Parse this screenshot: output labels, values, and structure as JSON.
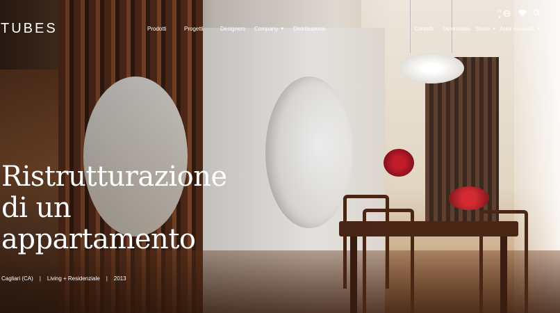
{
  "brand": {
    "logo": "TUBES"
  },
  "nav": {
    "left": [
      {
        "label": "Prodotti",
        "caret": false
      },
      {
        "label": "Progetti",
        "caret": false
      },
      {
        "label": "Designers",
        "caret": false
      },
      {
        "label": "Company",
        "caret": true
      },
      {
        "label": "Distribuzione",
        "caret": false
      }
    ],
    "right": [
      {
        "label": "Contatti",
        "caret": false
      },
      {
        "label": "Downloads",
        "caret": false
      },
      {
        "label": "Storie",
        "caret": true
      },
      {
        "label": "Area riservata",
        "caret": true
      }
    ],
    "caret_glyph": "▼"
  },
  "utility": {
    "language": "IT",
    "language_caret": "▾",
    "icons": [
      "globe-icon",
      "heart-icon",
      "search-icon"
    ]
  },
  "hero": {
    "title_lines": [
      "Ristrutturazione",
      "di un",
      "appartamento"
    ],
    "meta": {
      "location": "Cagliari (CA)",
      "separator": "|",
      "category": "Living + Residenziale",
      "year": "2013"
    }
  },
  "colors": {
    "text": "#ffffff",
    "accent_red": "#c21b2a"
  }
}
